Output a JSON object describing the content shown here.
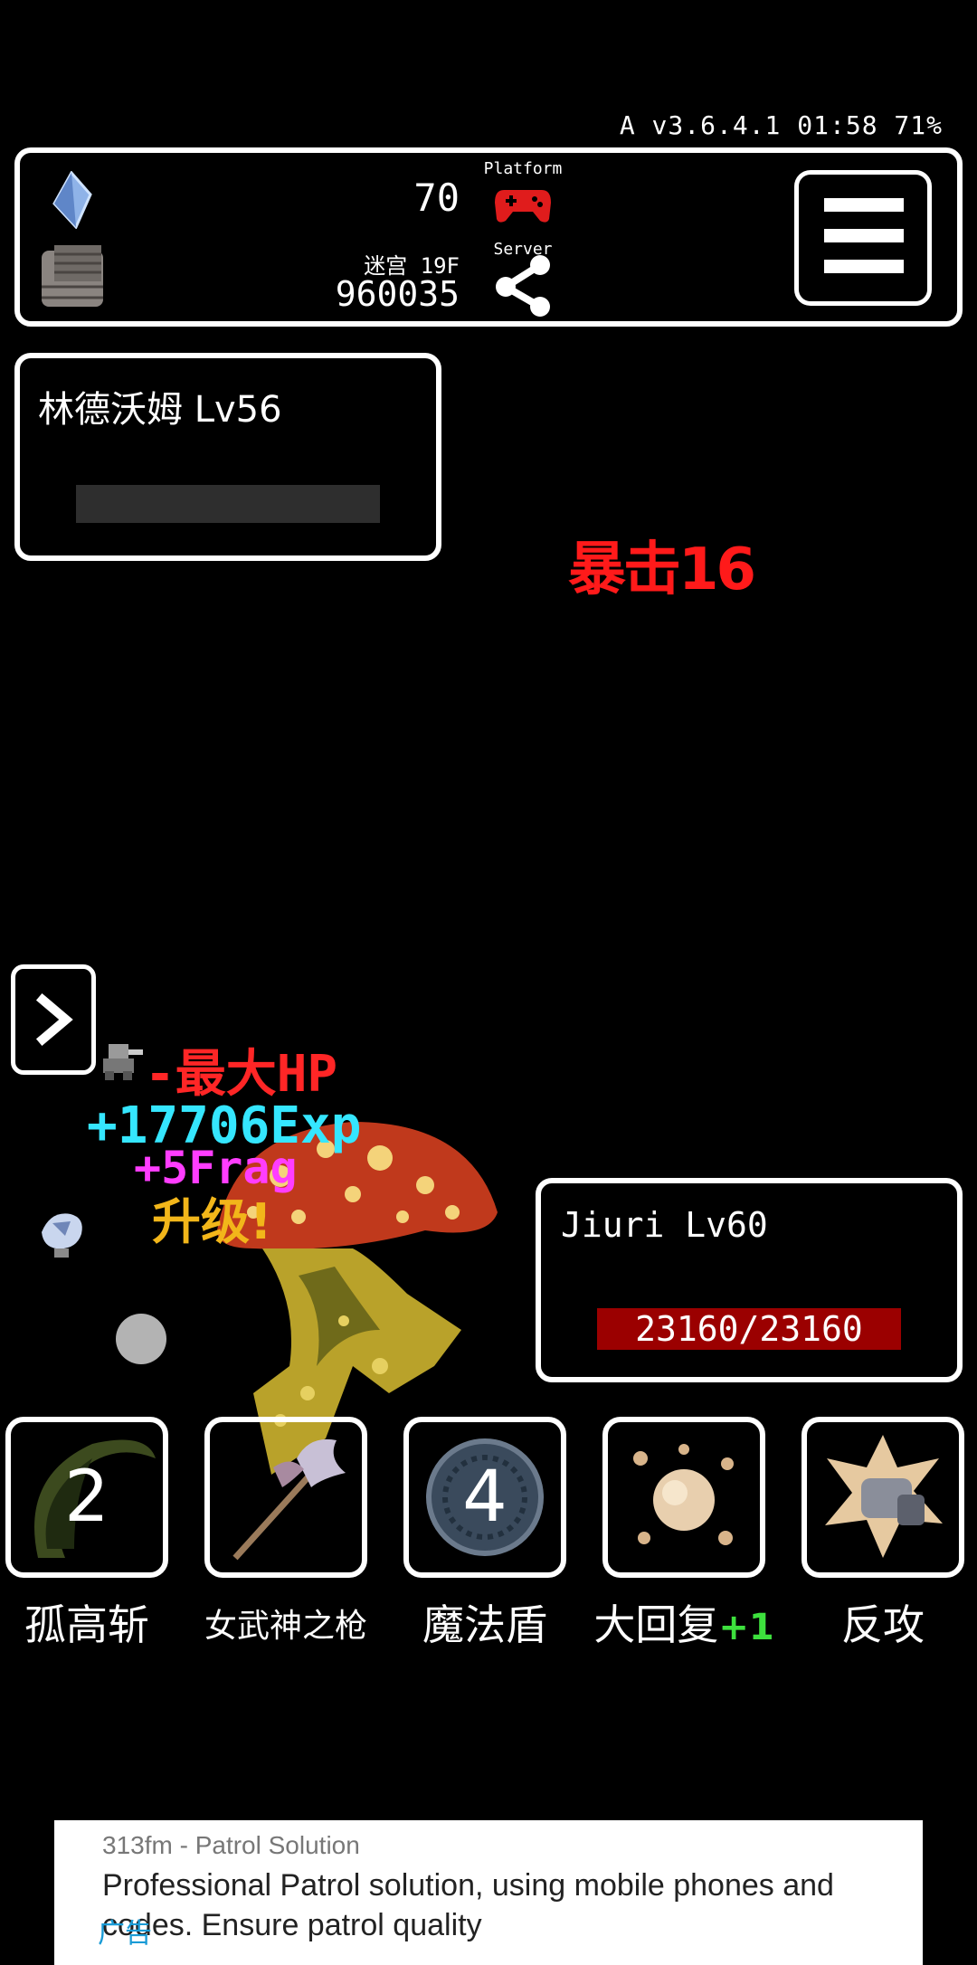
{
  "status": {
    "text": "A v3.6.4.1 01:58 71%"
  },
  "top_bar": {
    "gem_count": "70",
    "dungeon_label": "迷宫 19F",
    "score_value": "960035",
    "platform_label": "Platform",
    "server_label": "Server",
    "gem_icon": "crystal-icon",
    "floor_icon": "brick-floor-icon",
    "platform_icon": "gamepad-icon",
    "server_icon": "share-icon",
    "menu_icon": "hamburger-menu-icon",
    "colors": {
      "gamepad": "#e01c1c"
    }
  },
  "player": {
    "name_level": "林德沃姆 Lv56"
  },
  "battle": {
    "crit_text": "暴击16",
    "floats": {
      "hp": "-最大HP",
      "exp": "+17706Exp",
      "frag": "+5Frag",
      "level_up": "升级!"
    },
    "colors": {
      "crit": "#ff1a1a",
      "hp": "#ff2626",
      "exp": "#35e6ff",
      "frag": "#ff3dff",
      "level_up": "#f2b61a"
    }
  },
  "enemy": {
    "name_level": "Jiuri Lv60",
    "hp_text": "23160/23160",
    "hp_current": 23160,
    "hp_max": 23160,
    "colors": {
      "hp_bar": "#9b0000"
    }
  },
  "skills": [
    {
      "label": "孤高斩",
      "count": "2",
      "icon": "crescent-slash-icon"
    },
    {
      "label": "女武神之枪",
      "count": "",
      "icon": "halberd-icon"
    },
    {
      "label": "魔法盾",
      "count": "4",
      "icon": "magic-shield-icon"
    },
    {
      "label": "大回复",
      "bonus": "+1",
      "icon": "heal-burst-icon"
    },
    {
      "label": "反攻",
      "count": "",
      "icon": "counter-fist-icon"
    }
  ],
  "ad": {
    "source": "313fm - Patrol Solution",
    "text": "Professional Patrol solution, using mobile phones and codes. Ensure patrol quality",
    "tag": "广告"
  }
}
